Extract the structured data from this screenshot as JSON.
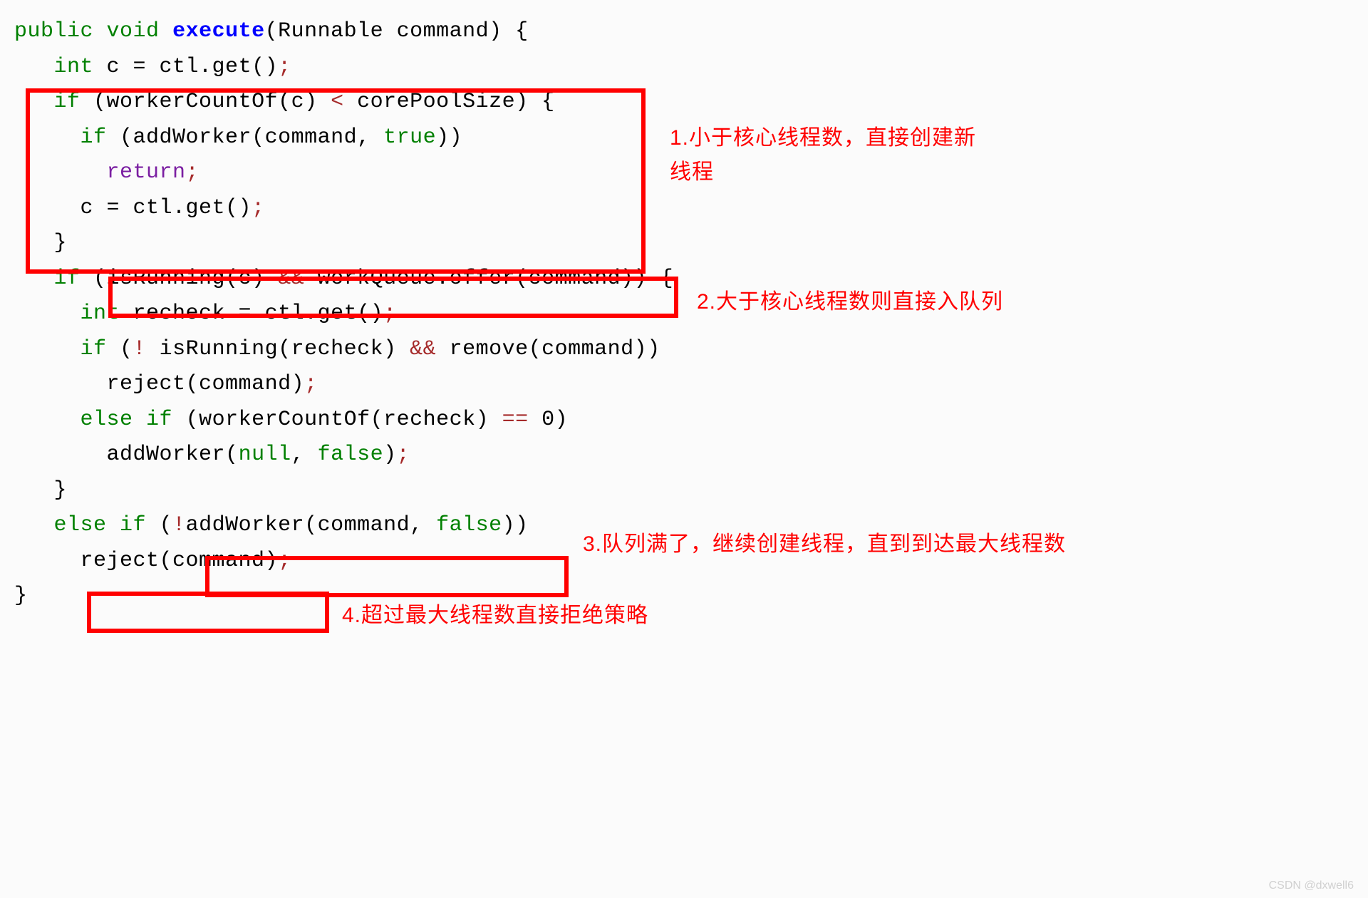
{
  "code": {
    "l1_public": "public",
    "l1_void": "void",
    "l1_fn": "execute",
    "l1_rest": "(Runnable command) {",
    "l2_int": "int",
    "l2_rest": " c = ctl.get()",
    "l3_if": "if",
    "l3_open": " (workerCountOf(c) ",
    "l3_lt": "<",
    "l3_rest": " corePoolSize) {",
    "l4_if": "if",
    "l4_open": " (addWorker(command, ",
    "l4_true": "true",
    "l4_rest": "))",
    "l5_return": "return",
    "l6_rest": "c = ctl.get()",
    "l7_brace": "}",
    "l8_if": "if",
    "l8_open": " (isRunning(c) ",
    "l8_and": "&&",
    "l8_rest": " workQueue.offer(command)) {",
    "l9_int": "int",
    "l9_rest": " recheck = ctl.get()",
    "l10_if": "if",
    "l10_open": " (",
    "l10_not": "!",
    "l10_mid": " isRunning(recheck) ",
    "l10_and": "&&",
    "l10_rest": " remove(command))",
    "l11_rest": "reject(command)",
    "l12_else": "else",
    "l12_if": "if",
    "l12_open": " (workerCountOf(recheck) ",
    "l12_eq": "==",
    "l12_rest": " 0)",
    "l13_open": "addWorker(",
    "l13_null": "null",
    "l13_comma": ", ",
    "l13_false": "false",
    "l13_rest": ")",
    "l14_brace": "}",
    "l15_else": "else",
    "l15_if": "if",
    "l15_open": " (",
    "l15_not": "!",
    "l15_mid": "addWorker(command, ",
    "l15_false": "false",
    "l15_rest": "))",
    "l16_rest": "reject(command)",
    "l17_brace": "}"
  },
  "annotations": {
    "a1": "1.小于核心线程数，直接创建新线程",
    "a2": "2.大于核心线程数则直接入队列",
    "a3": "3.队列满了，继续创建线程，直到到达最大线程数",
    "a4": "4.超过最大线程数直接拒绝策略"
  },
  "watermark": "CSDN @dxwell6"
}
